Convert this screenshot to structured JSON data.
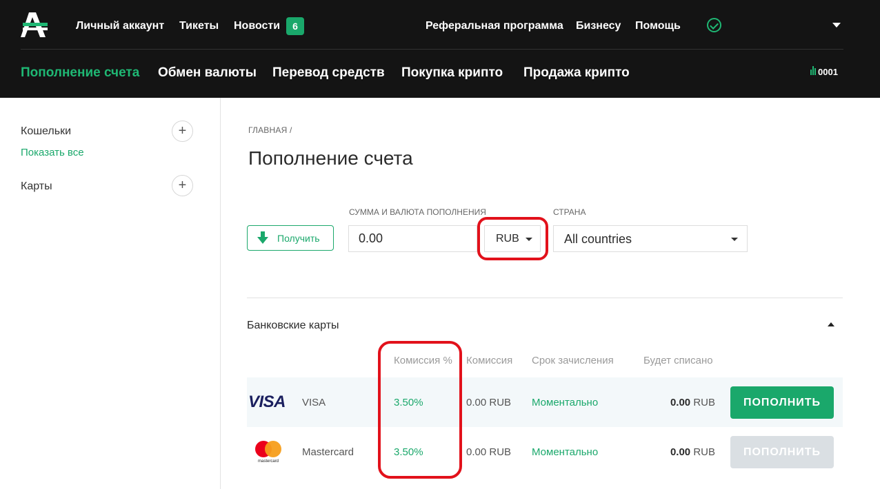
{
  "header": {
    "top_nav": [
      "Личный аккаунт",
      "Тикеты",
      "Новости",
      "Реферальная программа",
      "Бизнесу",
      "Помощь"
    ],
    "news_badge": "6",
    "sub_nav": [
      "Пополнение счета",
      "Обмен валюты",
      "Перевод средств",
      "Покупка крипто",
      "Продажа крипто"
    ],
    "account_number": "0001"
  },
  "sidebar": {
    "wallets_label": "Кошельки",
    "show_all": "Показать все",
    "cards_label": "Карты",
    "plus": "+"
  },
  "main": {
    "breadcrumb": "ГЛАВНАЯ /",
    "title": "Пополнение счета",
    "receive_label": "Получить",
    "amount_label": "СУММА И ВАЛЮТА ПОПОЛНЕНИЯ",
    "amount_value": "0.00",
    "currency": "RUB",
    "country_label": "СТРАНА",
    "country": "All countries"
  },
  "methods": {
    "section_title": "Банковские карты",
    "headers": [
      "Комиссия %",
      "Комиссия",
      "Срок зачисления",
      "Будет списано"
    ],
    "rows": [
      {
        "logo": "VISA",
        "name": "VISA",
        "pct": "3.50%",
        "fee": "0.00 RUB",
        "time": "Моментально",
        "debit_amount": "0.00",
        "debit_cur": "RUB",
        "button": "ПОПОЛНИТЬ",
        "enabled": true
      },
      {
        "logo": "mastercard",
        "name": "Mastercard",
        "pct": "3.50%",
        "fee": "0.00 RUB",
        "time": "Моментально",
        "debit_amount": "0.00",
        "debit_cur": "RUB",
        "button": "ПОПОЛНИТЬ",
        "enabled": false
      }
    ]
  },
  "colors": {
    "brand_green": "#1aa86b",
    "header_bg": "#141414",
    "highlight_red": "#e2111b"
  }
}
